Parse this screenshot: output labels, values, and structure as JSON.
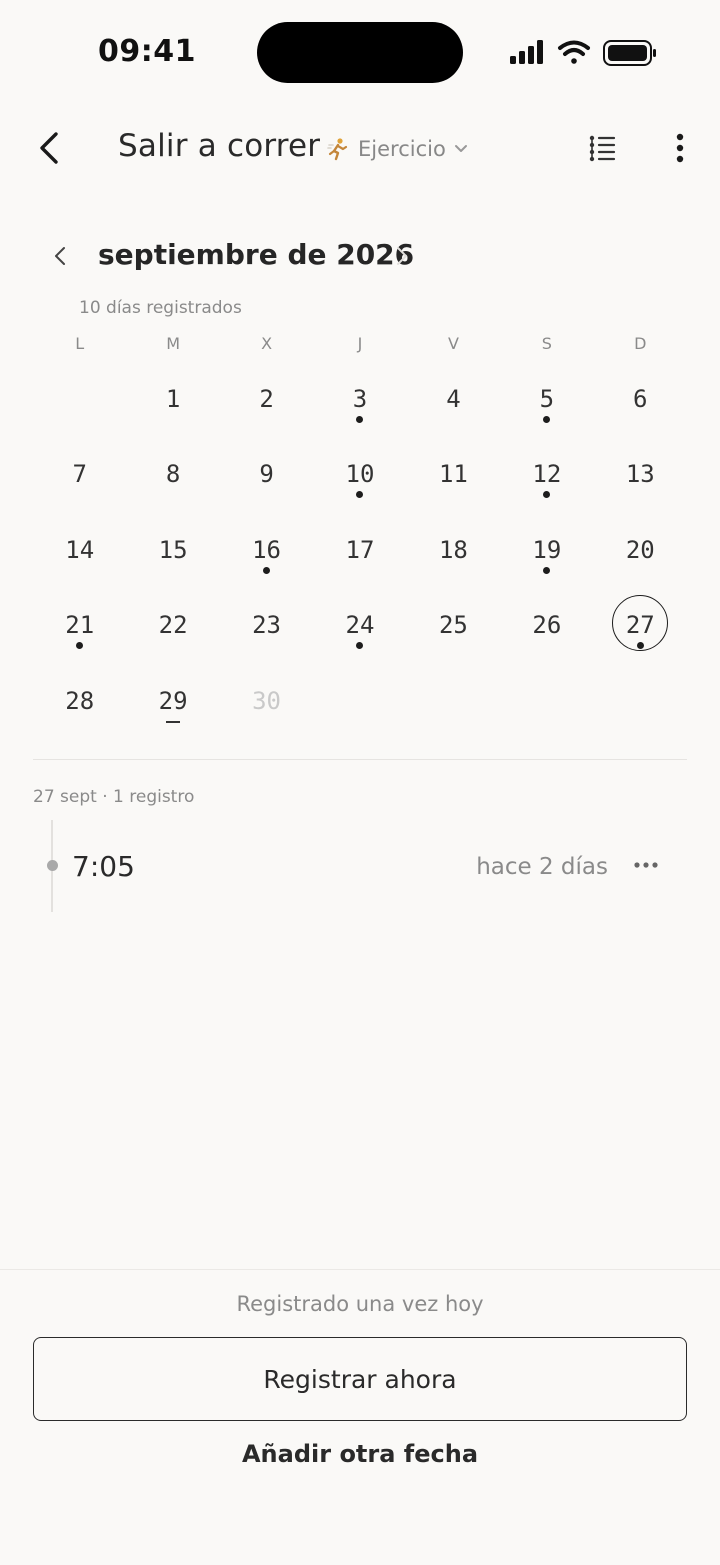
{
  "status_bar": {
    "time": "09:41"
  },
  "header": {
    "title": "Salir a correr",
    "category_label": "Ejercicio",
    "category_icon": "running-person-icon"
  },
  "calendar": {
    "month_label": "septiembre de 2026",
    "registered_count": "10 días registrados",
    "weekdays": [
      "L",
      "M",
      "X",
      "J",
      "V",
      "S",
      "D"
    ],
    "leading_blanks": 1,
    "days": [
      {
        "n": "1"
      },
      {
        "n": "2"
      },
      {
        "n": "3",
        "logged": true
      },
      {
        "n": "4"
      },
      {
        "n": "5",
        "logged": true
      },
      {
        "n": "6"
      },
      {
        "n": "7"
      },
      {
        "n": "8"
      },
      {
        "n": "9"
      },
      {
        "n": "10",
        "logged": true
      },
      {
        "n": "11"
      },
      {
        "n": "12",
        "logged": true
      },
      {
        "n": "13"
      },
      {
        "n": "14"
      },
      {
        "n": "15"
      },
      {
        "n": "16",
        "logged": true
      },
      {
        "n": "17"
      },
      {
        "n": "18"
      },
      {
        "n": "19",
        "logged": true
      },
      {
        "n": "20"
      },
      {
        "n": "21",
        "logged": true
      },
      {
        "n": "22"
      },
      {
        "n": "23"
      },
      {
        "n": "24",
        "logged": true
      },
      {
        "n": "25"
      },
      {
        "n": "26"
      },
      {
        "n": "27",
        "logged": true,
        "selected": true
      },
      {
        "n": "28"
      },
      {
        "n": "29",
        "today": true
      },
      {
        "n": "30",
        "future": true
      }
    ]
  },
  "log": {
    "header": "27 sept · 1 registro",
    "entries": [
      {
        "time": "7:05",
        "relative": "hace 2 días"
      }
    ]
  },
  "footer": {
    "status_text": "Registrado una vez hoy",
    "primary_label": "Registrar ahora",
    "secondary_label": "Añadir otra fecha"
  },
  "colors": {
    "background": "#faf9f7",
    "text": "#1f1f1f",
    "muted": "#8a8a8a",
    "dot": "#1d1d1d"
  }
}
